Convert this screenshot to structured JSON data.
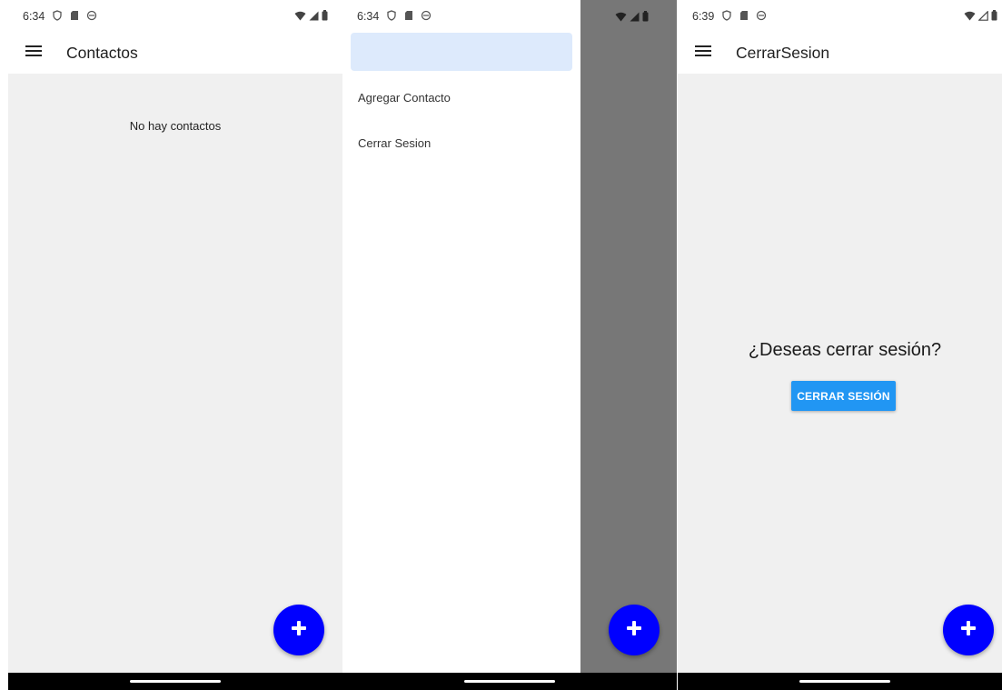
{
  "screens": [
    {
      "status": {
        "time": "6:34"
      },
      "appbar": {
        "title": "Contactos"
      },
      "content": {
        "empty_text": "No hay contactos"
      },
      "fab": {
        "icon": "plus-icon",
        "color": "#0000ff"
      }
    },
    {
      "status": {
        "time": "6:34"
      },
      "drawer": {
        "header_color": "#ddeafc",
        "items": [
          {
            "label": "Agregar Contacto"
          },
          {
            "label": "Cerrar Sesion"
          }
        ]
      },
      "scrim_color": "#777777",
      "fab": {
        "icon": "plus-icon",
        "color": "#0000ff"
      }
    },
    {
      "status": {
        "time": "6:39"
      },
      "appbar": {
        "title": "CerrarSesion"
      },
      "content": {
        "question": "¿Deseas cerrar sesión?",
        "button_label": "CERRAR SESIÓN",
        "button_color": "#2196f3"
      },
      "fab": {
        "icon": "plus-icon",
        "color": "#0000ff"
      }
    }
  ]
}
